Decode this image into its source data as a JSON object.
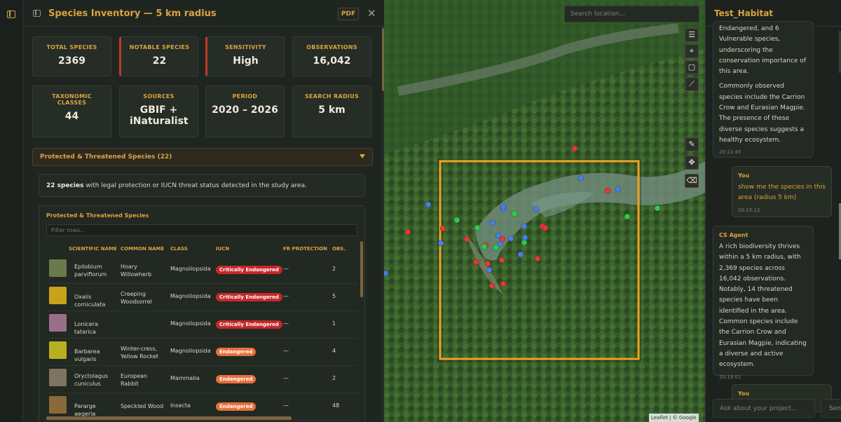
{
  "rail": {
    "icon": "sidebar-toggle-icon"
  },
  "panel": {
    "title": "Species Inventory — 5 km radius",
    "pdf_label": "PDF",
    "close_label": "✕",
    "stats": [
      {
        "label": "TOTAL SPECIES",
        "value": "2369",
        "alert": false
      },
      {
        "label": "NOTABLE SPECIES",
        "value": "22",
        "alert": true
      },
      {
        "label": "SENSITIVITY",
        "value": "High",
        "alert": true
      },
      {
        "label": "OBSERVATIONS",
        "value": "16,042",
        "alert": false
      },
      {
        "label": "TAXONOMIC CLASSES",
        "value": "44",
        "alert": false
      },
      {
        "label": "SOURCES",
        "value": "GBIF + iNaturalist",
        "alert": false
      },
      {
        "label": "PERIOD",
        "value": "2020 – 2026",
        "alert": false
      },
      {
        "label": "SEARCH RADIUS",
        "value": "5 km",
        "alert": false
      }
    ],
    "accordion_title": "Protected & Threatened Species (22)",
    "note_count": "22 species",
    "note_text": " with legal protection or IUCN threat status detected in the study area.",
    "table": {
      "title": "Protected & Threatened Species",
      "filter_placeholder": "Filter rows...",
      "headers": [
        "SCIENTIFIC NAME",
        "COMMON NAME",
        "CLASS",
        "IUCN",
        "FR PROTECTION",
        "OBS."
      ],
      "rows": [
        {
          "scientific": "Epilobium parviflorum",
          "common": "Hoary Willowherb",
          "class": "Magnoliopsida",
          "iucn": "Critically Endangered",
          "level": "ce",
          "fr": "—",
          "obs": "2",
          "thumb": "#6b7a4a"
        },
        {
          "scientific": "Oxalis corniculata",
          "common": "Creeping Woodsorrel",
          "class": "Magnoliopsida",
          "iucn": "Critically Endangered",
          "level": "ce",
          "fr": "—",
          "obs": "5",
          "thumb": "#c9a21a"
        },
        {
          "scientific": "Lonicera tatarica",
          "common": "",
          "class": "Magnoliopsida",
          "iucn": "Critically Endangered",
          "level": "ce",
          "fr": "—",
          "obs": "1",
          "thumb": "#9a6f8a"
        },
        {
          "scientific": "Barbarea vulgaris",
          "common": "Winter-cress, Yellow Rocket",
          "class": "Magnoliopsida",
          "iucn": "Endangered",
          "level": "en",
          "fr": "—",
          "obs": "4",
          "thumb": "#b8b020"
        },
        {
          "scientific": "Oryctolagus cuniculus",
          "common": "European Rabbit",
          "class": "Mammalia",
          "iucn": "Endangered",
          "level": "en",
          "fr": "—",
          "obs": "2",
          "thumb": "#7d7462"
        },
        {
          "scientific": "Pararge aegeria",
          "common": "Speckled Wood",
          "class": "Insecta",
          "iucn": "Endangered",
          "level": "en",
          "fr": "—",
          "obs": "48",
          "thumb": "#8a6a3a"
        }
      ]
    }
  },
  "map": {
    "search_placeholder": "Search location...",
    "tools": [
      "layers-icon",
      "marker-icon",
      "rectangle-icon",
      "polyline-icon",
      "edit-icon",
      "move-icon",
      "erase-icon"
    ],
    "attribution": "Leaflet | © Google",
    "colors": {
      "red": "#e53935",
      "blue": "#4a7ee8",
      "green": "#2ecc4a",
      "selection": "#f0a020"
    }
  },
  "chat": {
    "title": "Test_Habitat",
    "messages": [
      {
        "who": "",
        "text": "Endangered, and 6 Vulnerable species, underscoring the conservation importance of this area.",
        "text2": "Commonly observed species include the Carrion Crow and Eurasian Magpie. The presence of these diverse species suggests a healthy ecosystem.",
        "time": "20:11:45",
        "user": false
      },
      {
        "who": "You",
        "text": "show me the species in this area (radius 5 km)",
        "time": "20:15:12",
        "user": true
      },
      {
        "who": "CS Agent",
        "text": "A rich biodiversity thrives within a 5 km radius, with 2,369 species across 16,042 observations. Notably, 14 threatened species have been identified in the area. Common species include the Carrion Crow and Eurasian Magpie, indicating a diverse and active ecosystem.",
        "time": "20:19:01",
        "user": false
      },
      {
        "who": "You",
        "text": "",
        "time": "",
        "user": true
      }
    ],
    "input_placeholder": "Ask about your project...",
    "send_label": "Sen"
  }
}
